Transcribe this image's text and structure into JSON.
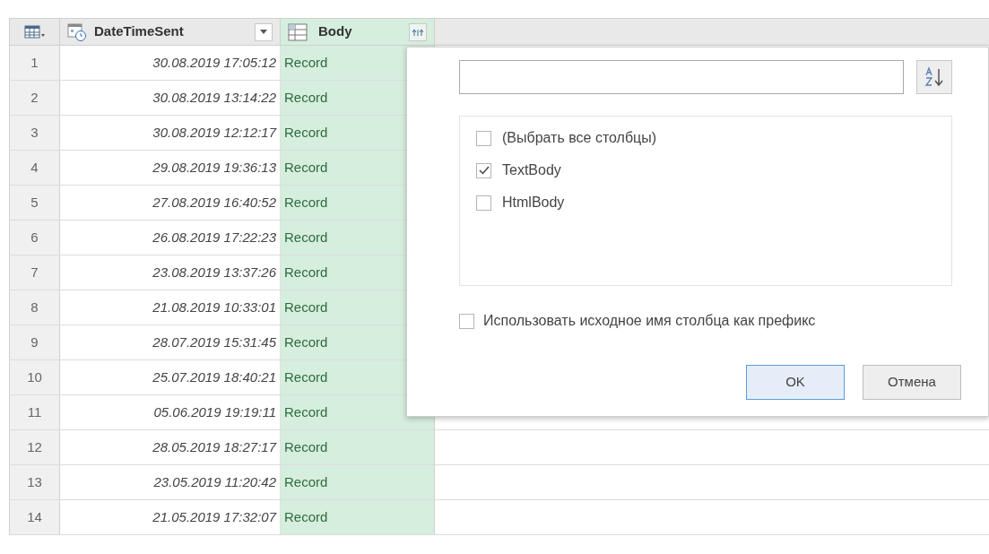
{
  "table": {
    "columns": [
      {
        "label": "DateTimeSent",
        "kind": "datetime"
      },
      {
        "label": "Body",
        "kind": "table"
      }
    ],
    "rows": [
      {
        "index": "1",
        "date": "30.08.2019 17:05:12",
        "body": "Record"
      },
      {
        "index": "2",
        "date": "30.08.2019 13:14:22",
        "body": "Record"
      },
      {
        "index": "3",
        "date": "30.08.2019 12:12:17",
        "body": "Record"
      },
      {
        "index": "4",
        "date": "29.08.2019 19:36:13",
        "body": "Record"
      },
      {
        "index": "5",
        "date": "27.08.2019 16:40:52",
        "body": "Record"
      },
      {
        "index": "6",
        "date": "26.08.2019 17:22:23",
        "body": "Record"
      },
      {
        "index": "7",
        "date": "23.08.2019 13:37:26",
        "body": "Record"
      },
      {
        "index": "8",
        "date": "21.08.2019 10:33:01",
        "body": "Record"
      },
      {
        "index": "9",
        "date": "28.07.2019 15:31:45",
        "body": "Record"
      },
      {
        "index": "10",
        "date": "25.07.2019 18:40:21",
        "body": "Record"
      },
      {
        "index": "11",
        "date": "05.06.2019 19:19:11",
        "body": "Record"
      },
      {
        "index": "12",
        "date": "28.05.2019 18:27:17",
        "body": "Record"
      },
      {
        "index": "13",
        "date": "23.05.2019 11:20:42",
        "body": "Record"
      },
      {
        "index": "14",
        "date": "21.05.2019 17:32:07",
        "body": "Record"
      }
    ]
  },
  "expand_popup": {
    "columns": [
      {
        "label": "(Выбрать все столбцы)",
        "checked": false
      },
      {
        "label": "TextBody",
        "checked": true
      },
      {
        "label": "HtmlBody",
        "checked": false
      }
    ],
    "prefix_option": {
      "label": "Использовать исходное имя столбца как префикс",
      "checked": false
    },
    "buttons": [
      {
        "label": "OK",
        "kind": "primary"
      },
      {
        "label": "Отмена",
        "kind": "secondary"
      }
    ]
  }
}
